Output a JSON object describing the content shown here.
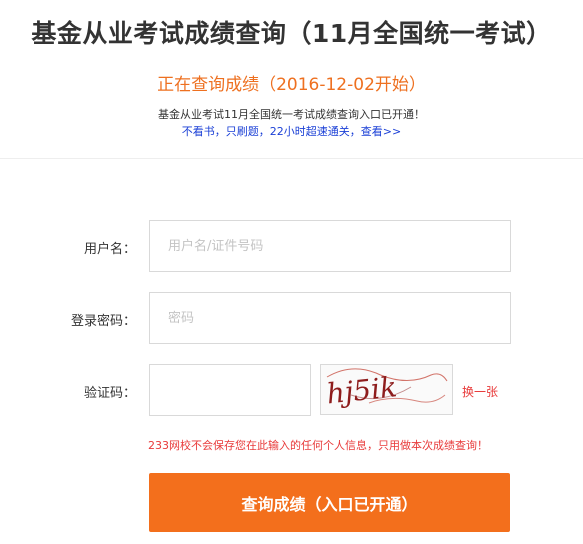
{
  "header": {
    "title": "基金从业考试成绩查询（11月全国统一考试）",
    "subtitle": "正在查询成绩（2016-12-02开始）",
    "notice": "基金从业考试11月全国统一考试成绩查询入口已开通！",
    "promo_link": "不看书，只刷题，22小时超速通关，查看>>"
  },
  "form": {
    "username": {
      "label": "用户名：",
      "placeholder": "用户名/证件号码",
      "value": ""
    },
    "password": {
      "label": "登录密码：",
      "placeholder": "密码",
      "value": ""
    },
    "captcha": {
      "label": "验证码：",
      "value": "",
      "image_text": "hj5ik",
      "refresh_label": "换一张"
    },
    "privacy_notice": "233网校不会保存您在此输入的任何个人信息，只用做本次成绩查询！",
    "submit_label": "查询成绩（入口已开通）"
  },
  "colors": {
    "accent": "#f36f1c",
    "subtitle": "#ee7020",
    "link": "#1a3fd6",
    "warning": "#e83a3a"
  }
}
